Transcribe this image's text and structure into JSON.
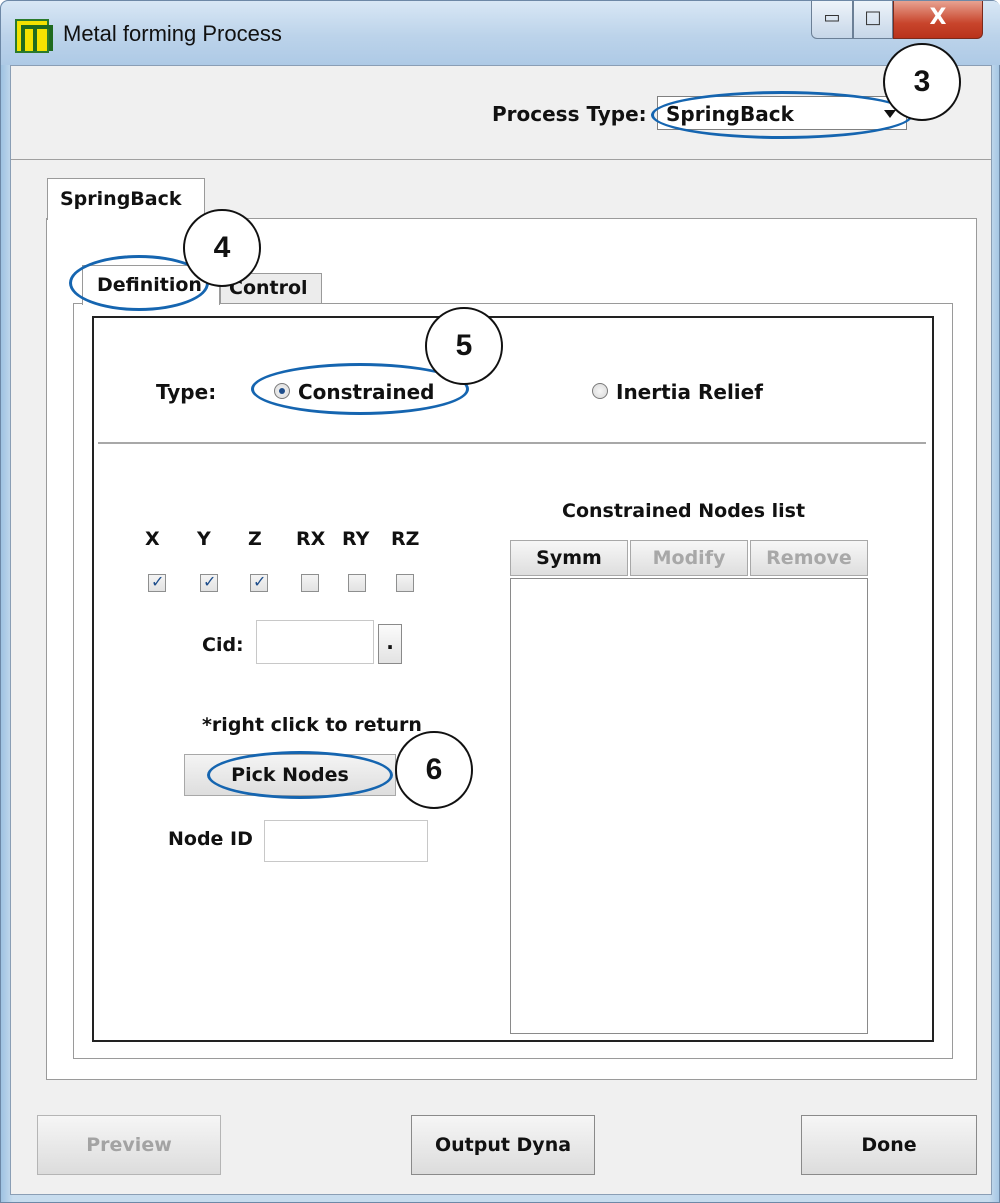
{
  "window": {
    "title": "Metal forming Process",
    "controls": {
      "minimize": "▭",
      "maximize": "□",
      "close": "X"
    }
  },
  "process_type": {
    "label": "Process Type:",
    "value": "SpringBack"
  },
  "outer_tab": {
    "label": "SpringBack"
  },
  "inner_tabs": [
    {
      "label": "Definition",
      "selected": true
    },
    {
      "label": "Control",
      "selected": false
    }
  ],
  "type_row": {
    "label": "Type:",
    "options": [
      {
        "label": "Constrained",
        "checked": true
      },
      {
        "label": "Inertia Relief",
        "checked": false
      }
    ]
  },
  "dof": {
    "labels": [
      "X",
      "Y",
      "Z",
      "RX",
      "RY",
      "RZ"
    ],
    "checked": [
      true,
      true,
      true,
      false,
      false,
      false
    ]
  },
  "cid": {
    "label": "Cid:",
    "value": "",
    "button": "."
  },
  "pick": {
    "hint": "*right click to return",
    "button": "Pick Nodes"
  },
  "node_id": {
    "label": "Node ID",
    "value": ""
  },
  "nodes_list": {
    "title": "Constrained Nodes list",
    "buttons": [
      {
        "label": "Symm",
        "enabled": true
      },
      {
        "label": "Modify",
        "enabled": false
      },
      {
        "label": "Remove",
        "enabled": false
      }
    ],
    "items": []
  },
  "bottom": {
    "preview": "Preview",
    "output": "Output Dyna",
    "done": "Done"
  },
  "annotations": [
    "3",
    "4",
    "5",
    "6"
  ],
  "colors": {
    "annotation": "#1565b0",
    "title_bar": "#bcd3ea",
    "close_button": "#c8452c"
  }
}
